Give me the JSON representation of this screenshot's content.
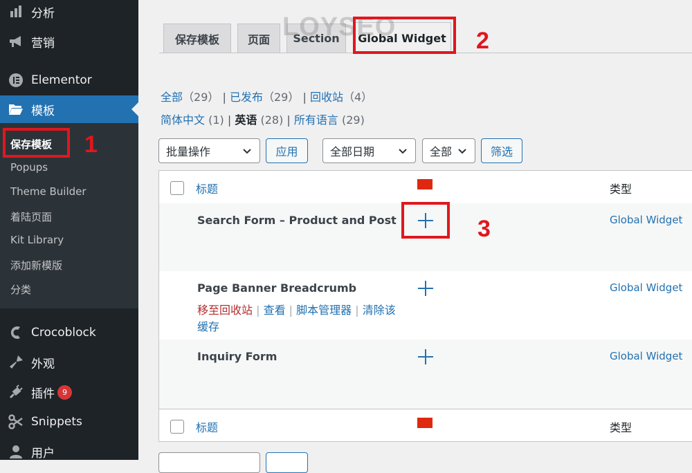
{
  "sidebar": {
    "items": [
      {
        "label": "分析",
        "icon": "bar-chart-icon"
      },
      {
        "label": "营销",
        "icon": "megaphone-icon"
      },
      {
        "label": "Elementor",
        "icon": "elementor-icon"
      },
      {
        "label": "模板",
        "icon": "folder-icon"
      },
      {
        "label": "Crocoblock",
        "icon": "crocoblock-icon"
      },
      {
        "label": "外观",
        "icon": "brush-icon"
      },
      {
        "label": "插件",
        "icon": "plugin-icon",
        "badge": "9"
      },
      {
        "label": "Snippets",
        "icon": "scissors-icon"
      },
      {
        "label": "用户",
        "icon": "user-icon"
      }
    ],
    "submenu": [
      "保存模板",
      "Popups",
      "Theme Builder",
      "着陆页面",
      "Kit Library",
      "添加新模版",
      "分类"
    ]
  },
  "tabs": [
    "保存模板",
    "页面",
    "Section",
    "Global Widget"
  ],
  "watermark": "LOYSEO",
  "annotations": [
    "1",
    "2",
    "3"
  ],
  "status_links": [
    {
      "label": "全部",
      "count": "（29）"
    },
    {
      "label": "已发布",
      "count": "（29）"
    },
    {
      "label": "回收站",
      "count": "（4）"
    }
  ],
  "lang_links": {
    "zh": "简体中文",
    "zh_count": "(1)",
    "en": "英语",
    "en_count": "(28)",
    "all": "所有语言",
    "all_count": "(29)"
  },
  "filters": {
    "bulk": "批量操作",
    "apply": "应用",
    "date": "全部日期",
    "all": "全部",
    "filter": "筛选"
  },
  "table": {
    "col_title": "标题",
    "col_type": "类型",
    "rows": [
      {
        "title": "Search Form – Product and Post",
        "type": "Global Widget"
      },
      {
        "title": "Page Banner Breadcrumb",
        "type": "Global Widget",
        "actions": [
          "移至回收站",
          "查看",
          "脚本管理器",
          "清除该缓存"
        ]
      },
      {
        "title": "Inquiry Form",
        "type": "Global Widget"
      }
    ]
  },
  "colors": {
    "accent": "#2271b1",
    "sidebar": "#1d2327",
    "annotation": "#e0171e",
    "flag": "#de2910"
  }
}
